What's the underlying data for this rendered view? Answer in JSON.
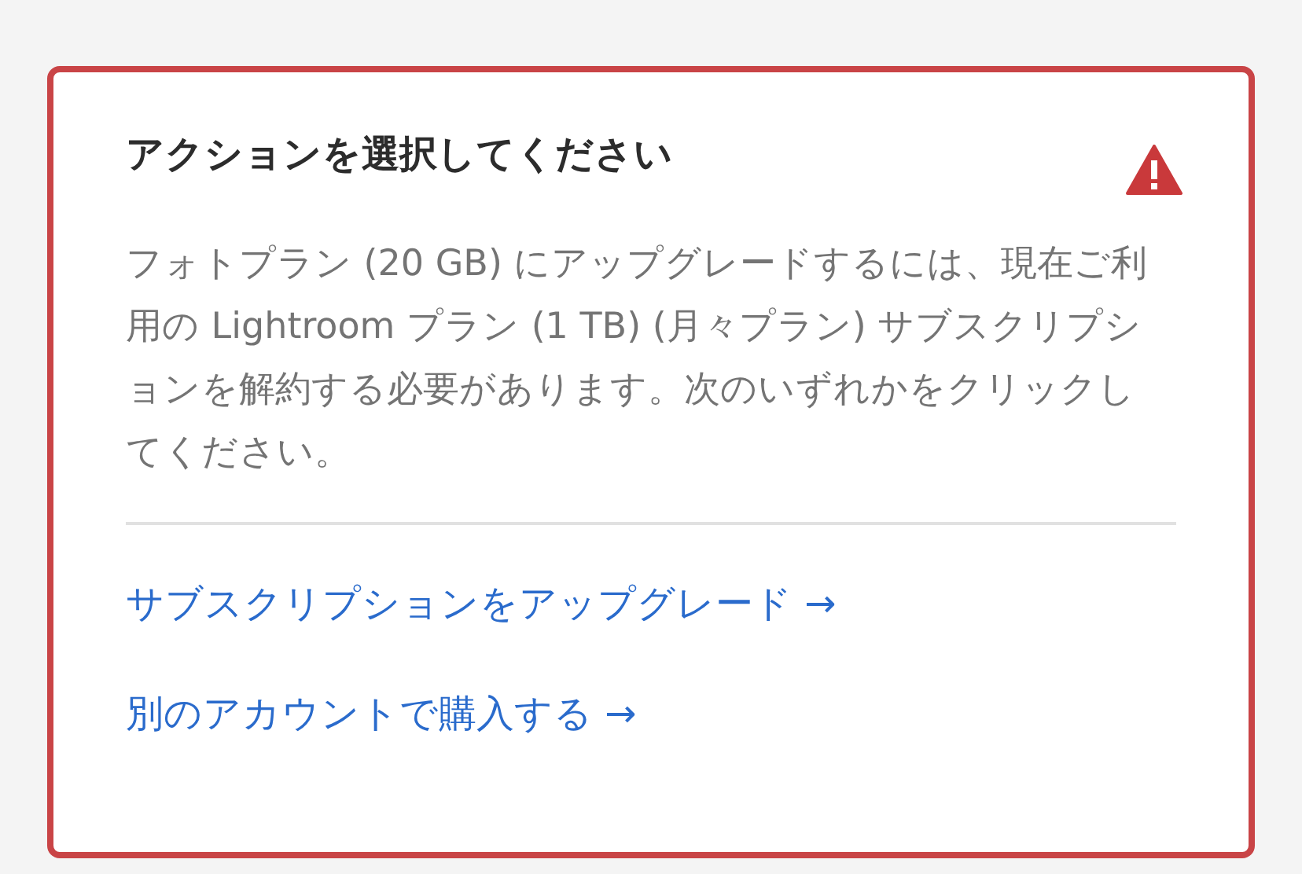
{
  "dialog": {
    "title": "アクションを選択してください",
    "message": "フォトプラン (20 GB) にアップグレードするには、現在ご利用の Lightroom プラン (1 TB) (月々プラン) サブスクリプションを解約する必要があります。次のいずれかをクリックしてください。",
    "links": [
      {
        "label": "サブスクリプションをアップグレード →"
      },
      {
        "label": "別のアカウントで購入する →"
      }
    ]
  }
}
